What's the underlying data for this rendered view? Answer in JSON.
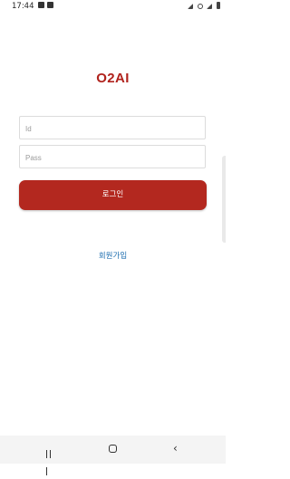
{
  "status_bar": {
    "time": "17:44"
  },
  "app": {
    "title": "O2AI"
  },
  "form": {
    "id_placeholder": "Id",
    "pass_placeholder": "Pass",
    "login_label": "로그인",
    "signup_label": "회원가입"
  },
  "icons": {
    "status_left": [
      "image-icon",
      "download-icon"
    ],
    "status_right": [
      "wifi-icon",
      "mute-icon",
      "signal-icon",
      "battery-icon"
    ],
    "nav": [
      "recents-icon",
      "home-icon",
      "back-icon"
    ]
  },
  "colors": {
    "brand": "#b0221c",
    "button": "#b3281f",
    "link": "#1f6fb0"
  }
}
